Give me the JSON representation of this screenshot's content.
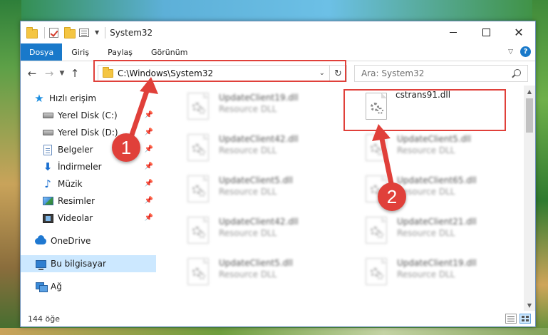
{
  "window": {
    "title": "System32"
  },
  "ribbon": {
    "tabs": [
      {
        "label": "Dosya"
      },
      {
        "label": "Giriş"
      },
      {
        "label": "Paylaş"
      },
      {
        "label": "Görünüm"
      }
    ],
    "help_label": "?"
  },
  "navigation": {
    "address": "C:\\Windows\\System32",
    "search_placeholder": "Ara: System32"
  },
  "sidebar": {
    "items": [
      {
        "label": "Hızlı erişim",
        "icon": "star-icon",
        "pinned": false
      },
      {
        "label": "Yerel Disk (C:)",
        "icon": "disk-icon",
        "pinned": true
      },
      {
        "label": "Yerel Disk (D:)",
        "icon": "disk-icon",
        "pinned": true
      },
      {
        "label": "Belgeler",
        "icon": "documents-icon",
        "pinned": true
      },
      {
        "label": "İndirmeler",
        "icon": "download-icon",
        "pinned": true
      },
      {
        "label": "Müzik",
        "icon": "music-icon",
        "pinned": true
      },
      {
        "label": "Resimler",
        "icon": "pictures-icon",
        "pinned": true
      },
      {
        "label": "Videolar",
        "icon": "videos-icon",
        "pinned": true
      },
      {
        "label": "OneDrive",
        "icon": "onedrive-icon",
        "pinned": false
      },
      {
        "label": "Bu bilgisayar",
        "icon": "computer-icon",
        "pinned": false,
        "selected": true
      },
      {
        "label": "Ağ",
        "icon": "network-icon",
        "pinned": false
      }
    ]
  },
  "files": {
    "left": [
      {
        "name": "UpdateClient19.dll",
        "type": "Resource DLL"
      },
      {
        "name": "UpdateClient42.dll",
        "type": "Resource DLL"
      },
      {
        "name": "UpdateClient5.dll",
        "type": "Resource DLL"
      },
      {
        "name": "UpdateClient42.dll",
        "type": "Resource DLL"
      },
      {
        "name": "UpdateClient5.dll",
        "type": "Resource DLL"
      }
    ],
    "right": [
      {
        "name": "cstrans91.dll",
        "type": ""
      },
      {
        "name": "UpdateClient5.dll",
        "type": "Resource DLL"
      },
      {
        "name": "UpdateClient65.dll",
        "type": "Resource DLL"
      },
      {
        "name": "UpdateClient21.dll",
        "type": "Resource DLL"
      },
      {
        "name": "UpdateClient19.dll",
        "type": "Resource DLL"
      }
    ]
  },
  "status": {
    "item_count": "144 öğe"
  },
  "annotations": {
    "badge_1": "1",
    "badge_2": "2"
  },
  "colors": {
    "accent": "#1979ca",
    "highlight": "#e0403a",
    "selected_bg": "#cce8ff"
  }
}
